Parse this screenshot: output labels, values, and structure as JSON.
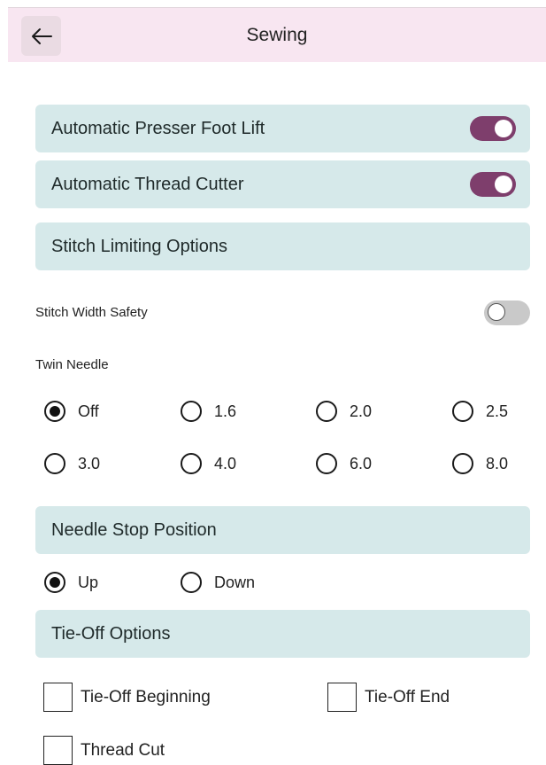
{
  "header": {
    "title": "Sewing",
    "back_icon": "arrow-left-icon"
  },
  "toggles": {
    "presser_foot_lift": {
      "label": "Automatic Presser Foot Lift",
      "on": true
    },
    "thread_cutter": {
      "label": "Automatic Thread Cutter",
      "on": true
    },
    "stitch_width_safety": {
      "label": "Stitch Width Safety",
      "on": false
    }
  },
  "sections": {
    "stitch_limiting": "Stitch Limiting Options",
    "needle_stop": "Needle Stop Position",
    "tie_off": "Tie-Off Options"
  },
  "twin_needle": {
    "label": "Twin Needle",
    "options": [
      "Off",
      "1.6",
      "2.0",
      "2.5",
      "3.0",
      "4.0",
      "6.0",
      "8.0"
    ],
    "selected": "Off"
  },
  "needle_stop": {
    "options": [
      "Up",
      "Down"
    ],
    "selected": "Up"
  },
  "tie_off": {
    "beginning": {
      "label": "Tie-Off Beginning",
      "checked": false
    },
    "end": {
      "label": "Tie-Off End",
      "checked": false
    },
    "thread_cut": {
      "label": "Thread Cut",
      "checked": false
    }
  },
  "colors": {
    "header_bg": "#f8e6f1",
    "panel_bg": "#d6e9ea",
    "toggle_on": "#7e3e6c",
    "toggle_off": "#c9c9c9"
  }
}
